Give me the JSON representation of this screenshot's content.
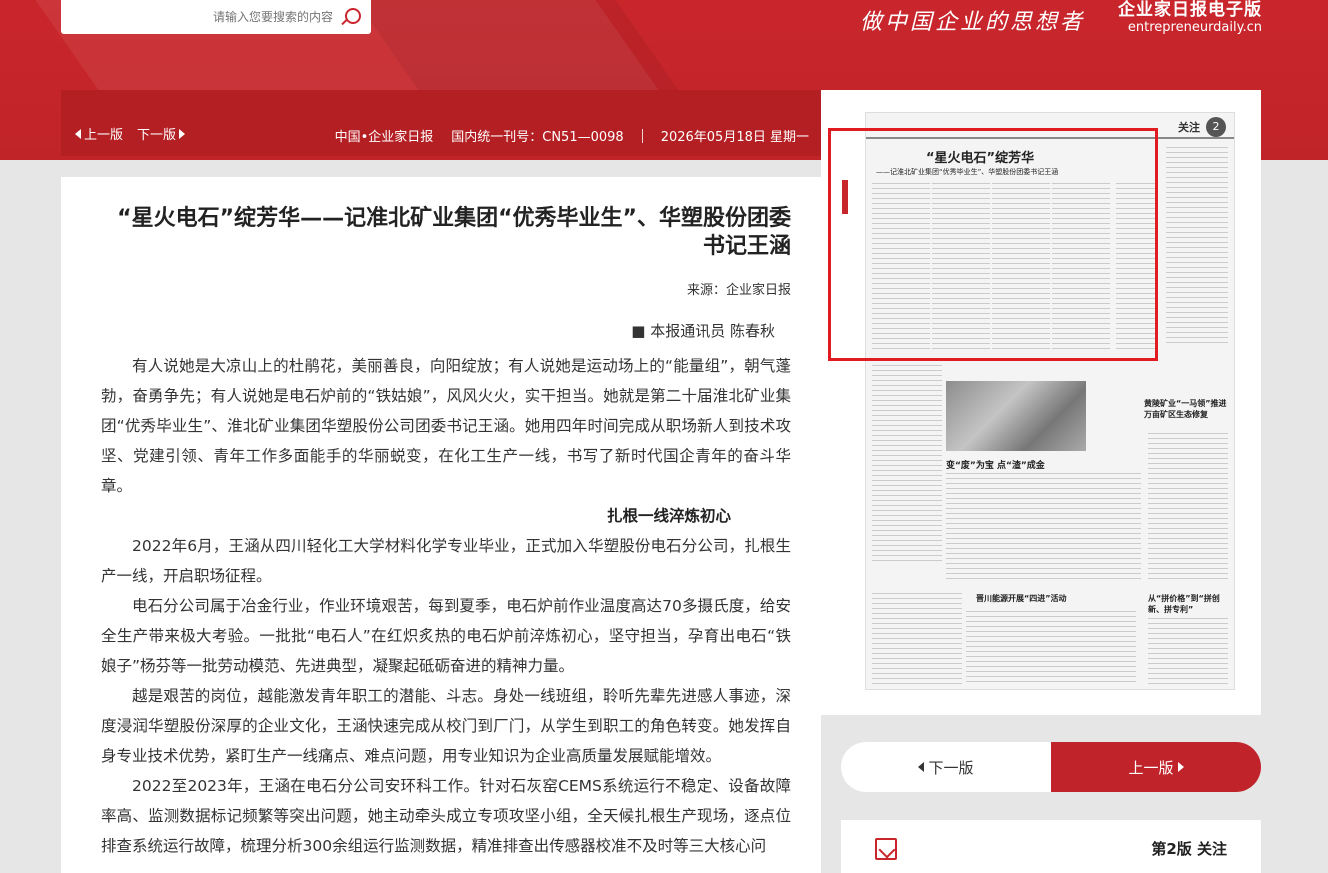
{
  "header": {
    "search_placeholder": "请输入您要搜索的内容",
    "brand_cn": "企业家日报电子版",
    "brand_en": "entrepreneurdaily.cn",
    "slogan": "做中国企业的思想者"
  },
  "infobar": {
    "prev_label": "上一版",
    "next_label": "下一版",
    "date": "2026年05月18日 星期一",
    "issn": "国内统一刊号：CN51—0098",
    "paper": "中国•企业家日报"
  },
  "article": {
    "title": "“星火电石”绽芳华——记准北矿业集团“优秀毕业生”、华塑股份团委书记王涵",
    "source": "来源：企业家日报",
    "byline": "■ 本报通讯员 陈春秋",
    "paragraphs": [
      "有人说她是大凉山上的杜鹃花，美丽善良，向阳绽放；有人说她是运动场上的“能量组”，朝气蓬勃，奋勇争先；有人说她是电石炉前的“铁姑娘”，风风火火，实干担当。她就是第二十届淮北矿业集团“优秀毕业生”、淮北矿业集团华塑股份公司团委书记王涵。她用四年时间完成从职场新人到技术攻坚、党建引领、青年工作多面能手的华丽蜕变，在化工生产一线，书写了新时代国企青年的奋斗华章。"
    ],
    "section1_title": "扎根一线淬炼初心",
    "section1_paragraphs": [
      "2022年6月，王涵从四川轻化工大学材料化学专业毕业，正式加入华塑股份电石分公司，扎根生产一线，开启职场征程。",
      "电石分公司属于冶金行业，作业环境艰苦，每到夏季，电石炉前作业温度高达70多摄氏度，给安全生产带来极大考验。一批批“电石人”在红炽炙热的电石炉前淬炼初心，坚守担当，孕育出电石“铁娘子”杨芬等一批劳动模范、先进典型，凝聚起砥砺奋进的精神力量。",
      "越是艰苦的岗位，越能激发青年职工的潜能、斗志。身处一线班组，聆听先辈先进感人事迹，深度浸润华塑股份深厚的企业文化，王涵快速完成从校门到厂门，从学生到职工的角色转变。她发挥自身专业技术优势，紧盯生产一线痛点、难点问题，用专业知识为企业高质量发展赋能增效。",
      "2022至2023年，王涵在电石分公司安环科工作。针对石灰窑CEMS系统运行不稳定、设备故障率高、监测数据标记频繁等突出问题，她主动牵头成立专项攻坚小组，全天候扎根生产现场，逐点位排查系统运行故障，梳理分析300余组运行监测数据，精准排查出传感器校准不及时等三大核心问"
    ]
  },
  "pagepanel": {
    "page_no": "2",
    "section": "关注",
    "thumb_headline_main": "“星火电石”绽芳华",
    "thumb_headline_sub": "——记淮北矿业集团“优秀毕业生”、华塑股份团委书记王涵",
    "thumb_h2": "变“废”为宝 点“渣”成金",
    "thumb_h3": "晋川能源开展“四进”活动",
    "thumb_h4": "黄陵矿业“一马领”推进万亩矿区生态修复",
    "thumb_h5": "从“拼价格”到“拼创新、拼专利”"
  },
  "pager": {
    "next_label": "下一版",
    "prev_label": "上一版"
  },
  "pagelist": {
    "page_label": "第2版 关注"
  },
  "colors": {
    "brand_red": "#c9262c",
    "info_red": "#b41f24",
    "highlight_red": "#e01b22"
  }
}
